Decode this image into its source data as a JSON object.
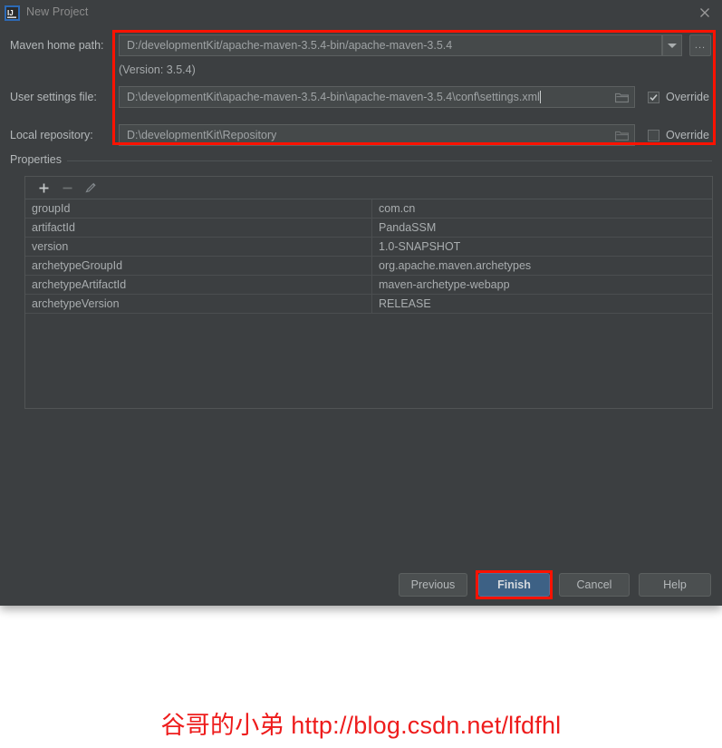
{
  "window": {
    "title": "New Project",
    "app_icon": "intellij-idea-logo",
    "close_icon": "close-icon"
  },
  "form": {
    "maven_home": {
      "label": "Maven home path:",
      "value": "D:/developmentKit/apache-maven-3.5.4-bin/apache-maven-3.5.4",
      "dropdown_icon": "chevron-down-icon",
      "browse_label": "...",
      "version_note": "(Version: 3.5.4)"
    },
    "user_settings": {
      "label": "User settings file:",
      "value": "D:\\developmentKit\\apache-maven-3.5.4-bin\\apache-maven-3.5.4\\conf\\settings.xml",
      "folder_icon": "folder-icon",
      "override_label": "Override",
      "override_checked": true
    },
    "local_repository": {
      "label": "Local repository:",
      "value": "D:\\developmentKit\\Repository",
      "folder_icon": "folder-icon",
      "override_label": "Override",
      "override_checked": false
    }
  },
  "properties": {
    "group_label": "Properties",
    "toolbar": {
      "add_icon": "plus-icon",
      "remove_icon": "minus-icon",
      "edit_icon": "pencil-icon"
    },
    "rows": [
      {
        "key": "groupId",
        "value": "com.cn"
      },
      {
        "key": "artifactId",
        "value": "PandaSSM"
      },
      {
        "key": "version",
        "value": "1.0-SNAPSHOT"
      },
      {
        "key": "archetypeGroupId",
        "value": "org.apache.maven.archetypes"
      },
      {
        "key": "archetypeArtifactId",
        "value": "maven-archetype-webapp"
      },
      {
        "key": "archetypeVersion",
        "value": "RELEASE"
      }
    ]
  },
  "footer": {
    "previous_label": "Previous",
    "finish_label": "Finish",
    "cancel_label": "Cancel",
    "help_label": "Help"
  },
  "annotations": {
    "highlight_color": "#fe1200"
  },
  "watermark": {
    "text": "谷哥的小弟 http://blog.csdn.net/lfdfhl",
    "color": "#ee1c1c"
  }
}
